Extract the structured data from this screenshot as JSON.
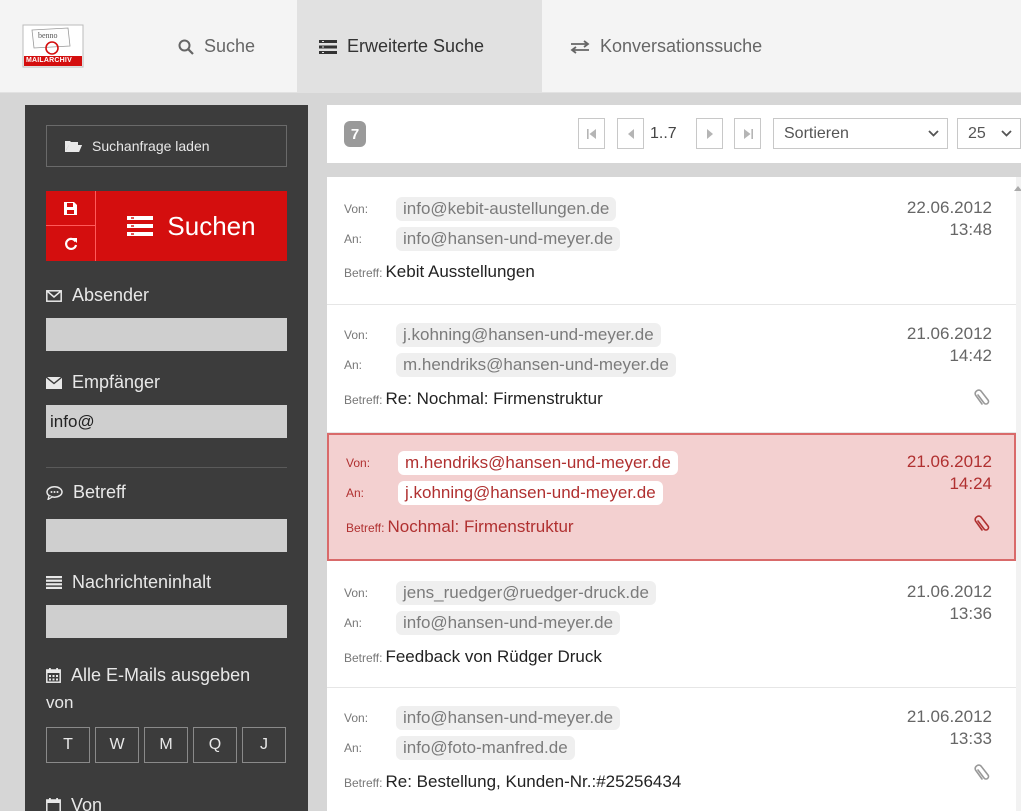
{
  "logo": {
    "top_text": "benno",
    "bottom_text": "MAILARCHIV"
  },
  "tabs": [
    {
      "label": "Suche",
      "icon": "search-icon"
    },
    {
      "label": "Erweiterte Suche",
      "icon": "list-icon",
      "active": true
    },
    {
      "label": "Konversationssuche",
      "icon": "exchange-icon"
    }
  ],
  "sidebar": {
    "load_label": "Suchanfrage laden",
    "search_label": "Suchen",
    "fields": {
      "sender": {
        "label": "Absender",
        "value": ""
      },
      "recipient": {
        "label": "Empfänger",
        "value": "info@"
      },
      "subject": {
        "label": "Betreff",
        "value": ""
      },
      "content": {
        "label": "Nachrichteninhalt",
        "value": ""
      }
    },
    "date_range": {
      "label": "Alle E-Mails ausgeben",
      "von": "von",
      "buttons": [
        "T",
        "W",
        "M",
        "Q",
        "J"
      ],
      "from_label": "Von"
    }
  },
  "toolbar": {
    "count": "7",
    "page_range": "1..7",
    "sort_label": "Sortieren",
    "per_page": "25"
  },
  "labels": {
    "from": "Von:",
    "to": "An:",
    "subject": "Betreff:"
  },
  "messages": [
    {
      "from": "info@kebit-austellungen.de",
      "to": "info@hansen-und-meyer.de",
      "subject": "Kebit Ausstellungen",
      "date": "22.06.2012",
      "time": "13:48",
      "attachment": false
    },
    {
      "from": "j.kohning@hansen-und-meyer.de",
      "to": "m.hendriks@hansen-und-meyer.de",
      "subject": "Re: Nochmal: Firmenstruktur",
      "date": "21.06.2012",
      "time": "14:42",
      "attachment": true
    },
    {
      "from": "m.hendriks@hansen-und-meyer.de",
      "to": "j.kohning@hansen-und-meyer.de",
      "subject": "Nochmal: Firmenstruktur",
      "date": "21.06.2012",
      "time": "14:24",
      "attachment": true,
      "selected": true
    },
    {
      "from": "jens_ruedger@ruedger-druck.de",
      "to": "info@hansen-und-meyer.de",
      "subject": "Feedback von Rüdger Druck",
      "date": "21.06.2012",
      "time": "13:36",
      "attachment": false
    },
    {
      "from": "info@hansen-und-meyer.de",
      "to": "info@foto-manfred.de",
      "subject": "Re: Bestellung, Kunden-Nr.:#25256434",
      "date": "21.06.2012",
      "time": "13:33",
      "attachment": true
    }
  ],
  "colors": {
    "accent": "#d40e0e",
    "sidebar": "#3c3c3c",
    "selected_bg": "#f3d0d0",
    "selected_text": "#b03030"
  }
}
